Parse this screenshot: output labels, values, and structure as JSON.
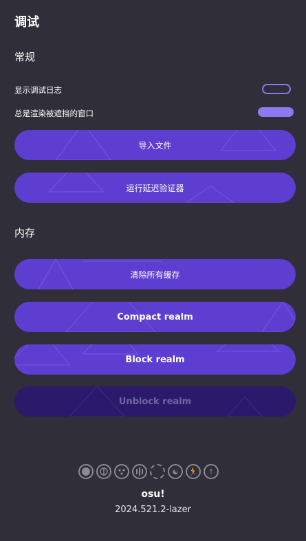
{
  "header": {
    "title": "调试"
  },
  "sections": {
    "general": "常规",
    "memory": "内存"
  },
  "settings": {
    "show_debug_log": {
      "label": "显示调试日志",
      "enabled": false
    },
    "always_render_occluded": {
      "label": "总是渲染被遮挡的窗口",
      "enabled": true
    }
  },
  "buttons": {
    "import_files": "导入文件",
    "run_latency_certifier": "运行延迟验证器",
    "clear_all_caches": "清除所有缓存",
    "compact_realm": "Compact realm",
    "block_realm": "Block realm",
    "unblock_realm": "Unblock realm"
  },
  "ruleset_icons": [
    "osu-icon",
    "taiko-icon",
    "catch-icon",
    "mania-icon",
    "empty-ruleset-icon",
    "yin-yang-icon",
    "runner-icon",
    "arrow-up-icon"
  ],
  "footer": {
    "name": "osu!",
    "version": "2024.521.2-lazer"
  },
  "colors": {
    "accent": "#5d3ed0",
    "background": "#302e38",
    "toggle": "#8c78f0",
    "disabled": "#2b1a6b"
  }
}
